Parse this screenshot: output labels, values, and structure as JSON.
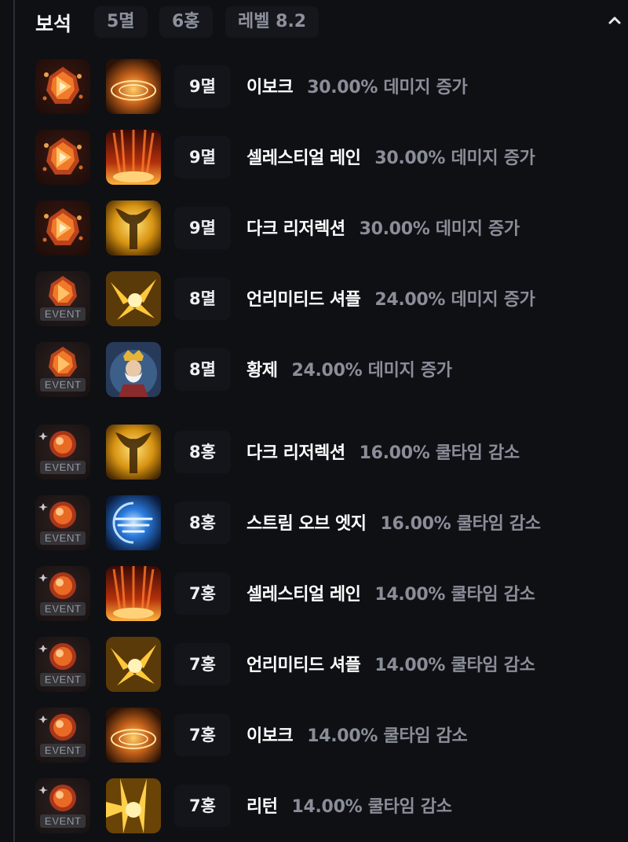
{
  "header": {
    "title": "보석",
    "summary": [
      "5멸",
      "6홍",
      "레벨 8.2"
    ]
  },
  "gems": [
    {
      "gem_icon": "red-damage-gem-icon",
      "skill_icon": "evoke-skill-icon",
      "level": "9멸",
      "skill": "이보크",
      "effect": "30.00% 데미지 증가"
    },
    {
      "gem_icon": "red-damage-gem-icon",
      "skill_icon": "celestial-rain-skill-icon",
      "level": "9멸",
      "skill": "셀레스티얼 레인",
      "effect": "30.00% 데미지 증가"
    },
    {
      "gem_icon": "red-damage-gem-icon",
      "skill_icon": "dark-resurrection-skill-icon",
      "level": "9멸",
      "skill": "다크 리저렉션",
      "effect": "30.00% 데미지 증가"
    },
    {
      "gem_icon": "event-damage-gem-icon",
      "skill_icon": "unlimited-shuffle-skill-icon",
      "level": "8멸",
      "skill": "언리미티드 셔플",
      "effect": "24.00% 데미지 증가"
    },
    {
      "gem_icon": "event-damage-gem-icon",
      "skill_icon": "emperor-card-skill-icon",
      "level": "8멸",
      "skill": "황제",
      "effect": "24.00% 데미지 증가"
    },
    {
      "gem_icon": "event-cooldown-gem-icon",
      "skill_icon": "dark-resurrection-skill-icon",
      "level": "8홍",
      "skill": "다크 리저렉션",
      "effect": "16.00% 쿨타임 감소"
    },
    {
      "gem_icon": "event-cooldown-gem-icon",
      "skill_icon": "stream-of-edge-skill-icon",
      "level": "8홍",
      "skill": "스트림 오브 엣지",
      "effect": "16.00% 쿨타임 감소"
    },
    {
      "gem_icon": "event-cooldown-gem-icon",
      "skill_icon": "celestial-rain-skill-icon",
      "level": "7홍",
      "skill": "셀레스티얼 레인",
      "effect": "14.00% 쿨타임 감소"
    },
    {
      "gem_icon": "event-cooldown-gem-icon",
      "skill_icon": "unlimited-shuffle-skill-icon",
      "level": "7홍",
      "skill": "언리미티드 셔플",
      "effect": "14.00% 쿨타임 감소"
    },
    {
      "gem_icon": "event-cooldown-gem-icon",
      "skill_icon": "evoke-skill-icon",
      "level": "7홍",
      "skill": "이보크",
      "effect": "14.00% 쿨타임 감소"
    },
    {
      "gem_icon": "event-cooldown-gem-icon",
      "skill_icon": "return-skill-icon",
      "level": "7홍",
      "skill": "리턴",
      "effect": "14.00% 쿨타임 감소"
    }
  ],
  "badge_text": "EVENT",
  "colors": {
    "background": "#0f1014",
    "pill": "#15171c",
    "effect_text": "#8a8e99",
    "gem_orange": "#ff8a1e"
  }
}
